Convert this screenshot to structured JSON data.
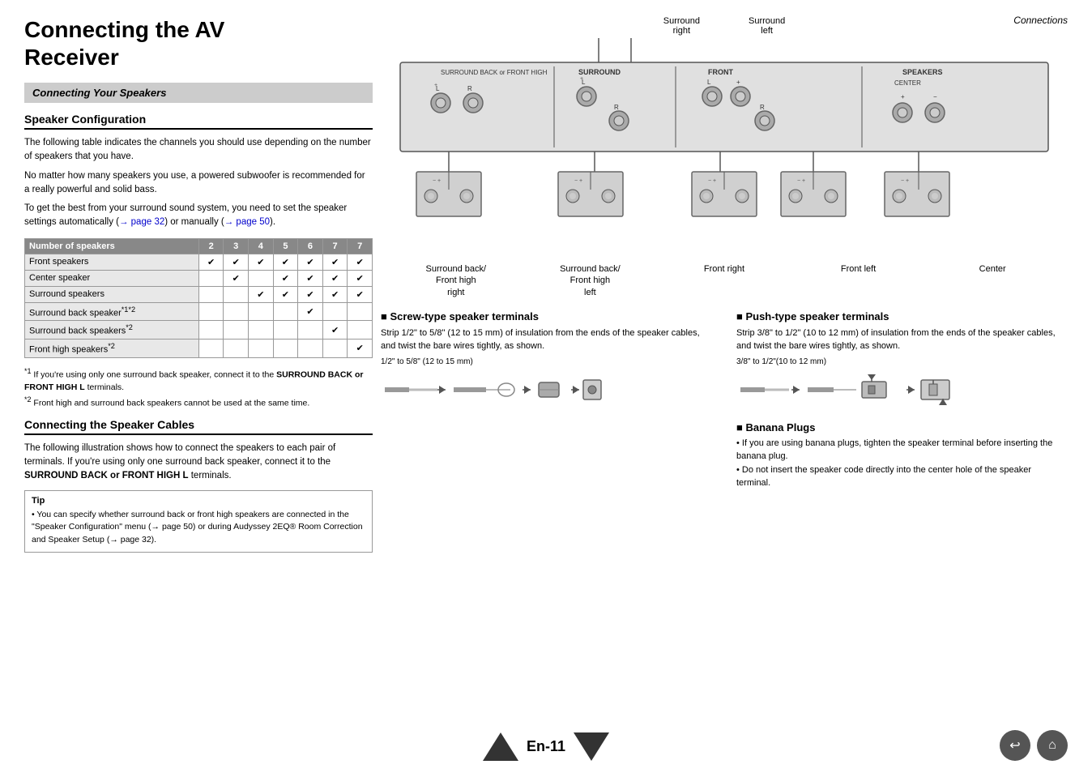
{
  "page": {
    "top_right_label": "Connections",
    "title_line1": "Connecting the AV",
    "title_line2": "Receiver",
    "section_header": "Connecting Your Speakers",
    "speaker_config_title": "Speaker Configuration",
    "speaker_config_p1": "The following table indicates the channels you should use depending on the number of speakers that you have.",
    "speaker_config_p2": "No matter how many speakers you use, a powered subwoofer is recommended for a really powerful and solid bass.",
    "speaker_config_p3": "To get the best from your surround sound system, you need to set the speaker settings automatically (",
    "speaker_config_link1": "→ page 32",
    "speaker_config_p3b": ") or manually (",
    "speaker_config_link2": "→ page 50",
    "speaker_config_p3c": ").",
    "table": {
      "col_header": "Number of speakers",
      "cols": [
        "2",
        "3",
        "4",
        "5",
        "6",
        "7",
        "7"
      ],
      "rows": [
        {
          "label": "Front speakers",
          "checks": [
            true,
            true,
            true,
            true,
            true,
            true,
            true
          ]
        },
        {
          "label": "Center speaker",
          "checks": [
            false,
            true,
            false,
            true,
            true,
            true,
            true
          ]
        },
        {
          "label": "Surround speakers",
          "checks": [
            false,
            false,
            true,
            true,
            true,
            true,
            true
          ]
        },
        {
          "label": "Surround back speaker*1*2",
          "checks": [
            false,
            false,
            false,
            false,
            true,
            false,
            false
          ]
        },
        {
          "label": "Surround back speakers*2",
          "checks": [
            false,
            false,
            false,
            false,
            false,
            true,
            false
          ]
        },
        {
          "label": "Front high speakers*2",
          "checks": [
            false,
            false,
            false,
            false,
            false,
            false,
            true
          ]
        }
      ]
    },
    "footnote1": "*1  If you're using only one surround back speaker, connect it to the SURROUND BACK or FRONT HIGH L terminals.",
    "footnote2": "*2  Front high and surround back speakers cannot be used at the same time.",
    "footnote1_bold": "SURROUND BACK or FRONT HIGH L",
    "cables_title": "Connecting the Speaker Cables",
    "cables_p1": "The following illustration shows how to connect the speakers to each pair of terminals. If you're using only one surround back speaker, connect it to the ",
    "cables_bold": "SURROUND BACK or FRONT HIGH L",
    "cables_p1b": " terminals.",
    "tip_label": "Tip",
    "tip_text": "• You can specify whether surround back or front high speakers are connected in the \"Speaker Configuration\" menu (→ page 50) or during Audyssey 2EQ® Room Correction and Speaker Setup (→ page 32).",
    "diagram": {
      "surround_right": "Surround\nright",
      "surround_left": "Surround\nleft",
      "speaker_labels": [
        "Surround back/\nFront high\nright",
        "Surround back/\nFront high\nleft",
        "Front right",
        "Front left",
        "Center"
      ]
    },
    "screw_title": "Screw-type speaker terminals",
    "screw_text": "Strip 1/2\" to 5/8\" (12 to 15 mm) of insulation from the ends of the speaker cables, and twist the bare wires tightly, as shown.",
    "screw_measure": "1/2\" to 5/8\" (12 to 15 mm)",
    "push_title": "Push-type speaker terminals",
    "push_text": "Strip 3/8\" to 1/2\" (10 to 12 mm) of insulation from the ends of the speaker cables, and twist the bare wires tightly, as shown.",
    "push_measure": "3/8\" to 1/2\"(10 to 12 mm)",
    "banana_title": "Banana Plugs",
    "banana_p1": "• If you are using banana plugs, tighten the speaker terminal before inserting the banana plug.",
    "banana_p2": "• Do not insert the speaker code directly into the center hole of the speaker terminal.",
    "page_number": "En-11"
  }
}
